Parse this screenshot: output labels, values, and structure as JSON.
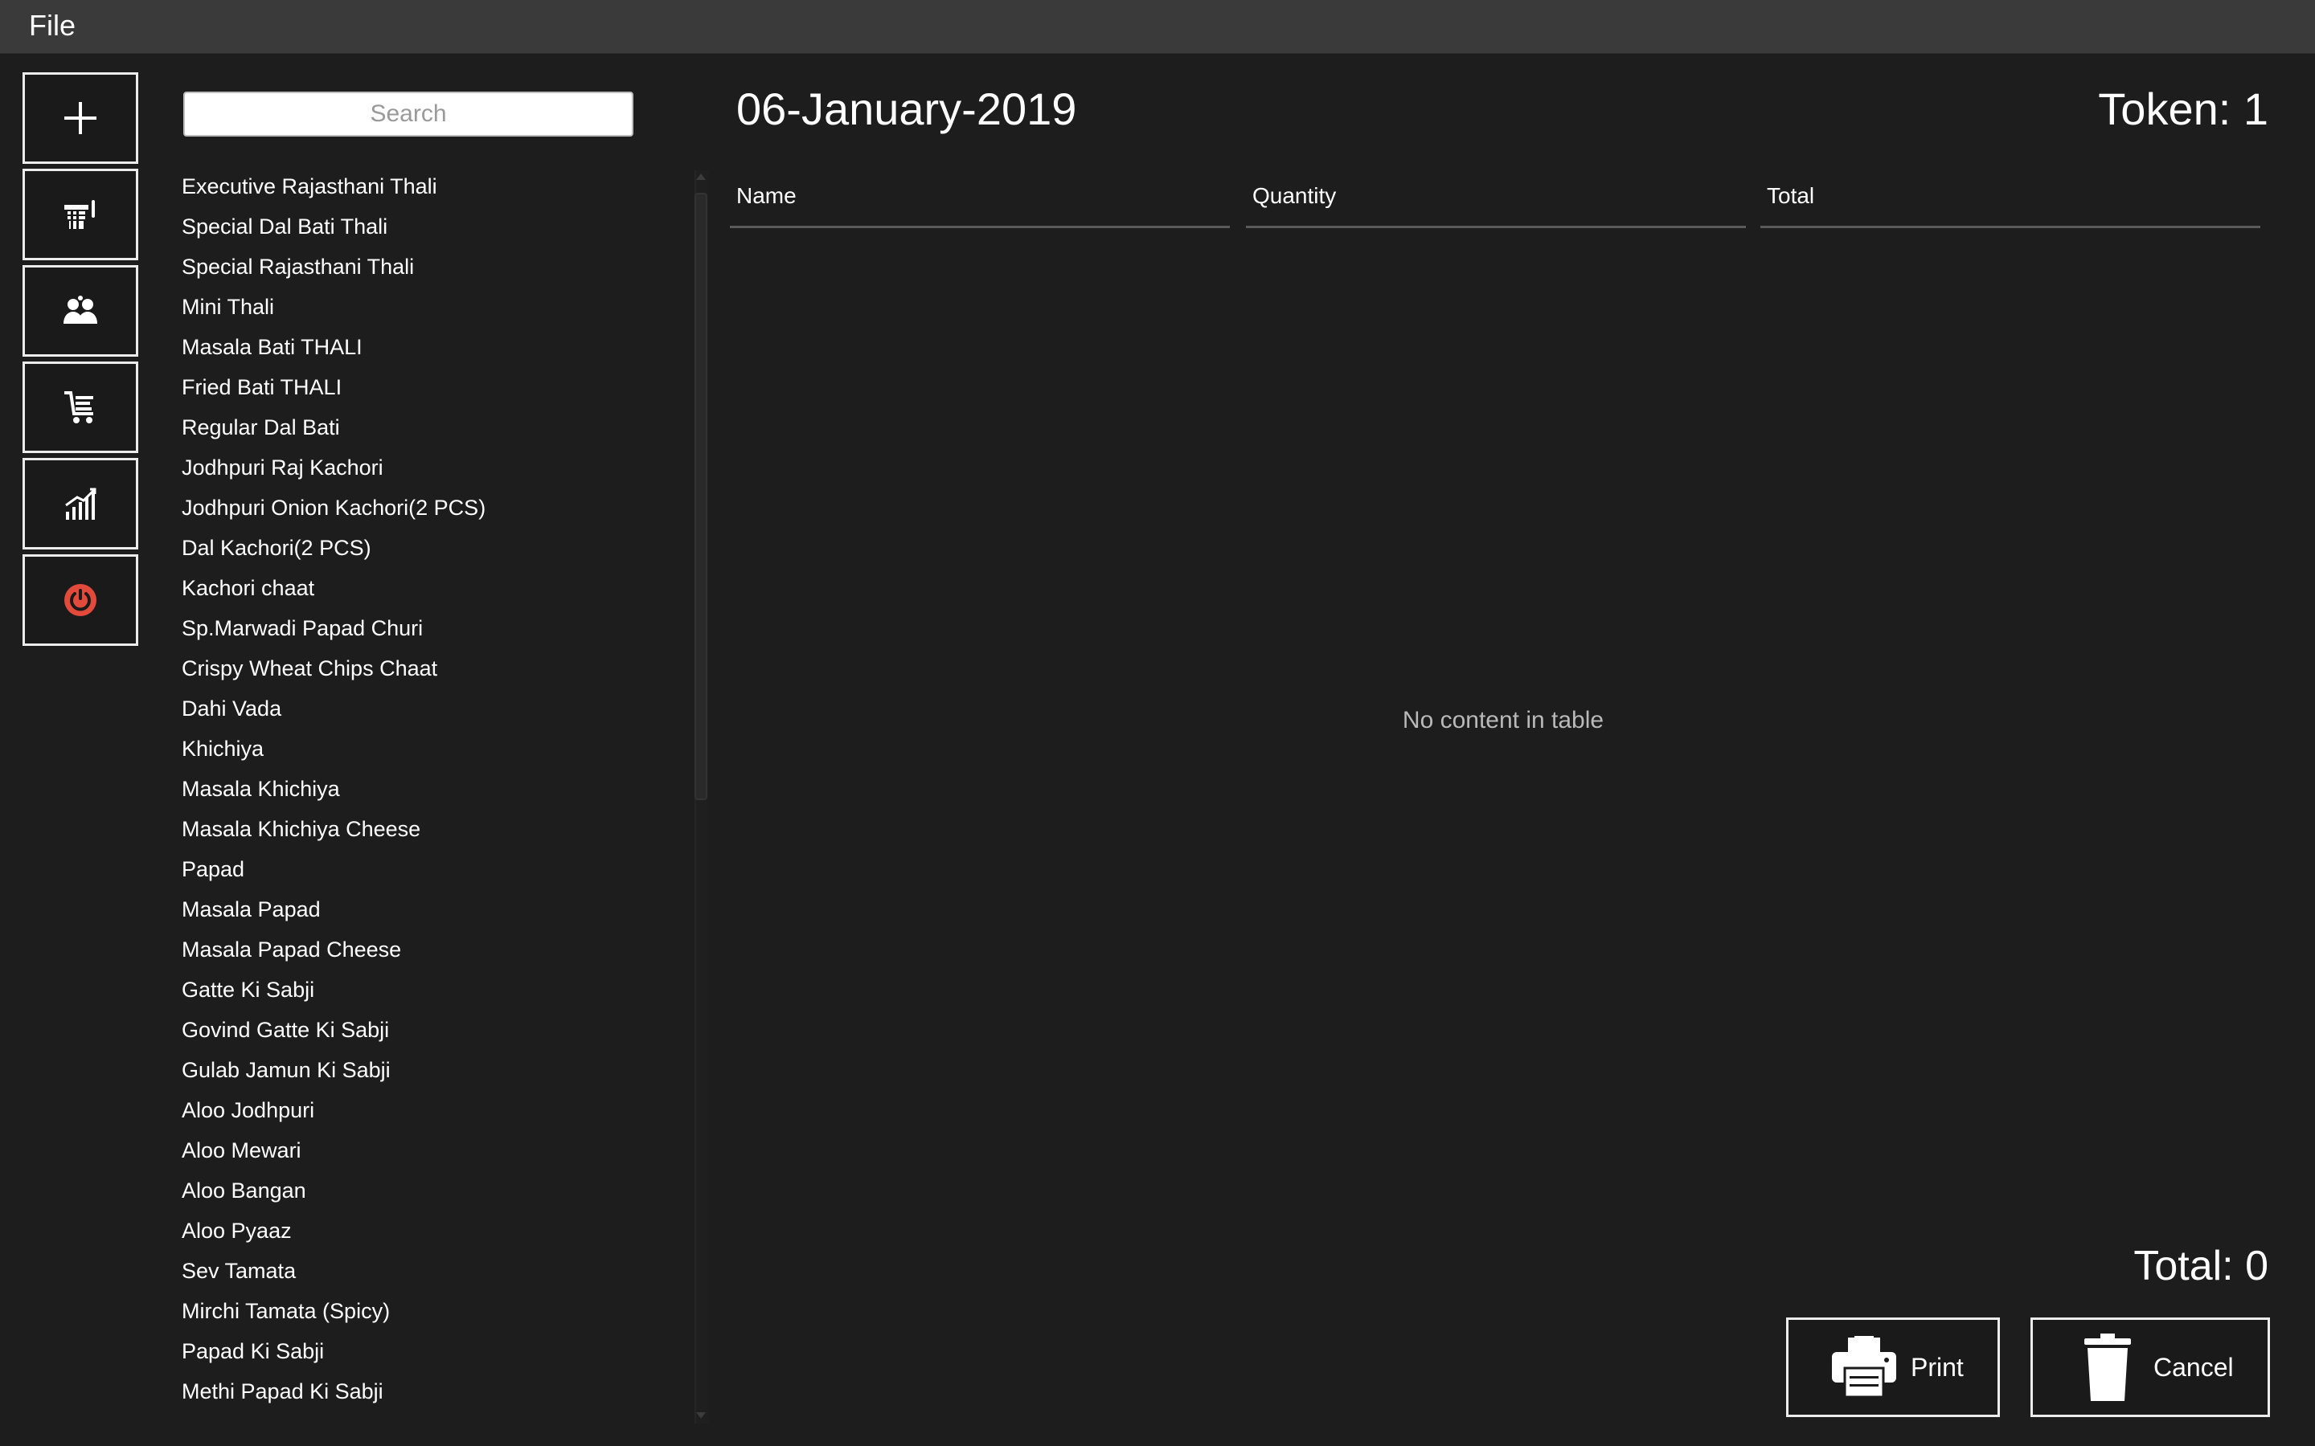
{
  "menubar": {
    "file_label": "File"
  },
  "sidebar": {
    "buttons": [
      {
        "name": "add-icon"
      },
      {
        "name": "menu-items-icon"
      },
      {
        "name": "users-icon"
      },
      {
        "name": "orders-cart-icon"
      },
      {
        "name": "sales-chart-icon"
      },
      {
        "name": "power-icon",
        "color": "#e24b3c"
      }
    ]
  },
  "search": {
    "placeholder": "Search",
    "value": ""
  },
  "menu_items": [
    "Executive Rajasthani Thali",
    "Special Dal Bati Thali",
    "Special Rajasthani Thali",
    "Mini Thali",
    "Masala Bati THALI",
    "Fried Bati THALI",
    "Regular Dal Bati",
    "Jodhpuri Raj Kachori",
    "Jodhpuri Onion Kachori(2 PCS)",
    "Dal Kachori(2 PCS)",
    "Kachori chaat",
    "Sp.Marwadi Papad Churi",
    "Crispy Wheat Chips Chaat",
    "Dahi Vada",
    "Khichiya",
    "Masala Khichiya",
    "Masala Khichiya Cheese",
    "Papad",
    "Masala Papad",
    "Masala Papad Cheese",
    "Gatte Ki Sabji",
    "Govind Gatte Ki Sabji",
    "Gulab Jamun Ki Sabji",
    "Aloo Jodhpuri",
    "Aloo Mewari",
    "Aloo Bangan",
    "Aloo Pyaaz",
    "Sev Tamata",
    "Mirchi Tamata (Spicy)",
    "Papad Ki Sabji",
    "Methi Papad Ki Sabji"
  ],
  "header": {
    "date": "06-January-2019",
    "token": "Token: 1"
  },
  "table": {
    "columns": [
      "Name",
      "Quantity",
      "Total"
    ],
    "empty_message": "No content in table"
  },
  "footer": {
    "total": "Total: 0",
    "print_label": "Print",
    "cancel_label": "Cancel"
  },
  "colors": {
    "background": "#1d1d1d",
    "menubar": "#3a3a3a",
    "border": "#ececec",
    "power_accent": "#e24b3c"
  }
}
